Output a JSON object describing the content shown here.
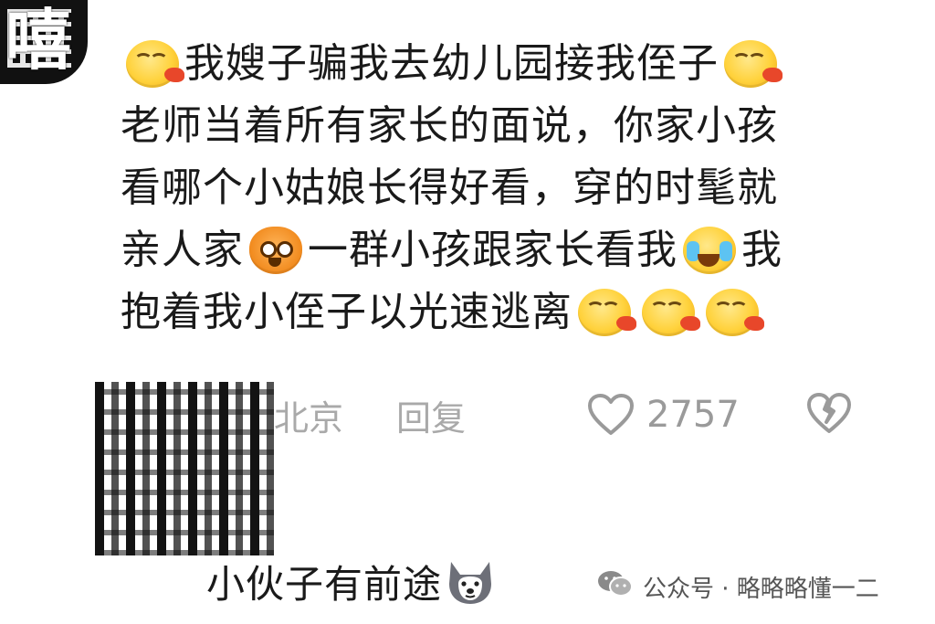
{
  "comment": {
    "lines": [
      {
        "pre_emoji": "laugh-tongue",
        "text": "我嫂子骗我去幼儿园接我侄子",
        "post_emoji": "laugh-tongue"
      },
      {
        "text": "老师当着所有家长的面说，你家小孩"
      },
      {
        "text": "看哪个小姑娘长得好看，穿的时髦就"
      },
      {
        "text_a": "亲人家",
        "mid_emoji": "bear-face",
        "text_b": "一群小孩跟家长看我",
        "mid_emoji_2": "cry-laugh",
        "text_c": "我"
      },
      {
        "text": "抱着我小侄子以光速逃离",
        "trailing_emojis": [
          "laugh-tongue",
          "laugh-tongue",
          "laugh-tongue"
        ]
      }
    ]
  },
  "meta": {
    "location": "北京",
    "reply_label": "回复",
    "like_icon": "heart-outline-icon",
    "like_count": "2757",
    "dislike_icon": "broken-heart-icon"
  },
  "reply": {
    "text": "小伙子有前途",
    "emoji": "husky-dog-face"
  },
  "watermark": {
    "icon": "wechat-icon",
    "text": "公众号 · 略略略懂一二"
  },
  "colors": {
    "text_primary": "#1a1a1a",
    "text_meta": "#a9a9a9",
    "background": "#ffffff"
  }
}
